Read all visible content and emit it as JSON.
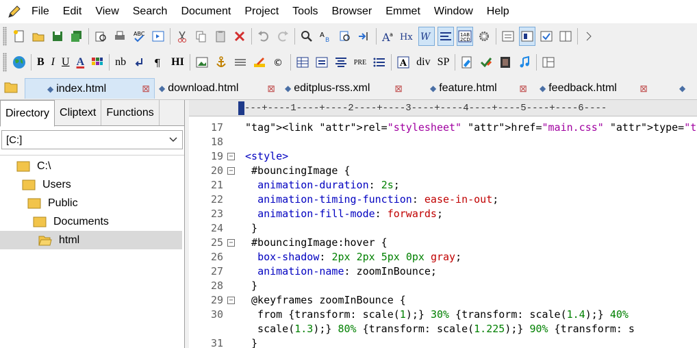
{
  "menu": [
    "File",
    "Edit",
    "View",
    "Search",
    "Document",
    "Project",
    "Tools",
    "Browser",
    "Emmet",
    "Window",
    "Help"
  ],
  "toolbar2_text": {
    "b": "B",
    "i": "I",
    "u": "U",
    "a": "A",
    "nb": "nb",
    "hi": "HI",
    "pre": "PRE",
    "div": "div",
    "sp": "SP"
  },
  "tabs": [
    {
      "label": "index.html",
      "active": true
    },
    {
      "label": "download.html",
      "active": false
    },
    {
      "label": "editplus-rss.xml",
      "active": false
    },
    {
      "label": "feature.html",
      "active": false
    },
    {
      "label": "feedback.html",
      "active": false
    }
  ],
  "panel": {
    "tabs": [
      "Directory",
      "Cliptext",
      "Functions"
    ],
    "drive": "[C:]",
    "tree": [
      {
        "label": "C:\\",
        "depth": 0,
        "selected": false
      },
      {
        "label": "Users",
        "depth": 1,
        "selected": false
      },
      {
        "label": "Public",
        "depth": 2,
        "selected": false
      },
      {
        "label": "Documents",
        "depth": 3,
        "selected": false
      },
      {
        "label": "html",
        "depth": 4,
        "selected": true
      }
    ]
  },
  "ruler": "---+----1----+----2----+----3----+----4----+----5----+----6----",
  "code": [
    {
      "n": "17",
      "fold": false,
      "text": "<link rel=\"stylesheet\" href=\"main.css\" type=\"text/css\">"
    },
    {
      "n": "18",
      "fold": false,
      "text": ""
    },
    {
      "n": "19",
      "fold": true,
      "text": "<style>"
    },
    {
      "n": "20",
      "fold": true,
      "text": " #bouncingImage {"
    },
    {
      "n": "21",
      "fold": false,
      "text": "  animation-duration: 2s;"
    },
    {
      "n": "22",
      "fold": false,
      "text": "  animation-timing-function: ease-in-out;"
    },
    {
      "n": "23",
      "fold": false,
      "text": "  animation-fill-mode: forwards;"
    },
    {
      "n": "24",
      "fold": false,
      "text": " }"
    },
    {
      "n": "25",
      "fold": true,
      "text": " #bouncingImage:hover {"
    },
    {
      "n": "26",
      "fold": false,
      "text": "  box-shadow: 2px 2px 5px 0px gray;"
    },
    {
      "n": "27",
      "fold": false,
      "text": "  animation-name: zoomInBounce;"
    },
    {
      "n": "28",
      "fold": false,
      "text": " }"
    },
    {
      "n": "29",
      "fold": true,
      "text": " @keyframes zoomInBounce {"
    },
    {
      "n": "30",
      "fold": false,
      "text": "  from {transform: scale(1);} 30% {transform: scale(1.4);} 40%"
    },
    {
      "n": "",
      "fold": false,
      "text": "  scale(1.3);} 80% {transform: scale(1.225);} 90% {transform: s"
    },
    {
      "n": "31",
      "fold": false,
      "text": " }"
    }
  ]
}
